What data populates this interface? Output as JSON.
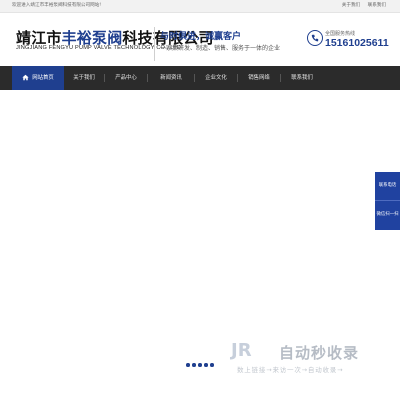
{
  "topbar": {
    "welcome": "欢迎进入靖江市丰裕泵阀科技有限公司网站!",
    "links": [
      "关于我们",
      "联系我们"
    ]
  },
  "header": {
    "company_name_prefix": "靖江市",
    "company_name_highlight": "丰裕泵阀",
    "company_name_suffix": "科技有限公司",
    "company_name_en": "JINGJIANG FENGYU PUMP VALVE TECHNOLOGY CO., LTD",
    "slogan_title": "与时俱进，诚赢客户",
    "slogan_sub": "一家集研发、制造、销售、服务于一体的企业",
    "hotline_label": "全国服务热线",
    "hotline_number": "15161025611",
    "phone_icon": "phone-icon"
  },
  "nav": {
    "items": [
      {
        "label": "网站首页",
        "active": true
      },
      {
        "label": "关于我们"
      },
      {
        "label": "产品中心"
      },
      {
        "label": "新闻资讯"
      },
      {
        "label": "企业文化"
      },
      {
        "label": "销售网络"
      },
      {
        "label": "联系我们"
      }
    ]
  },
  "side": {
    "contact_label": "联系电话",
    "wechat_label": "微信扫一扫"
  },
  "banner": {
    "slide_count": 5
  },
  "watermark": {
    "logo": "JR",
    "title": "自动秒收录",
    "subtitle": "数上链接→来访一次→自动收录→"
  },
  "colors": {
    "brand_blue": "#1f3f8f",
    "nav_bg": "#2b2b2b",
    "side_blue": "#2042a0"
  }
}
